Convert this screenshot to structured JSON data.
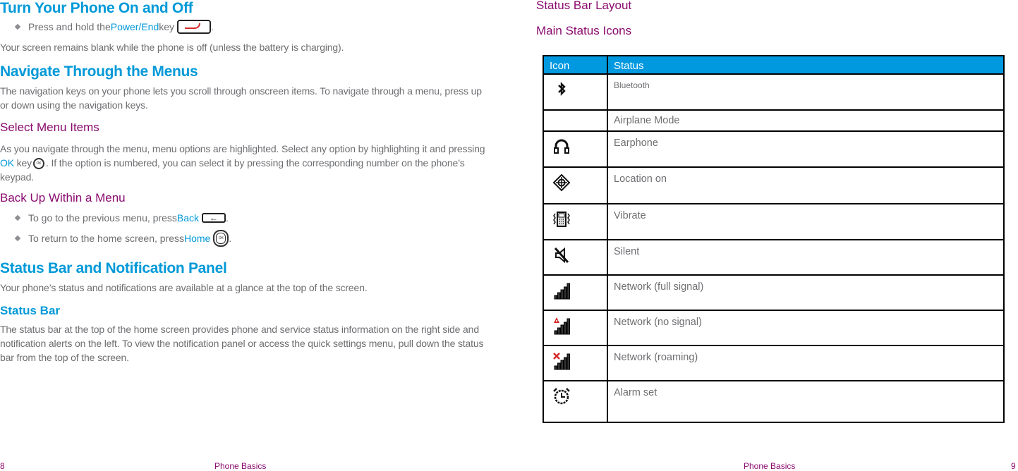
{
  "left_page": {
    "section1": {
      "title": "Turn Your Phone On and Off",
      "bullet": {
        "prefix": "Press and hold the ",
        "keyword": "Power/End",
        "suffix": " key",
        "icon": "power-end-key-icon",
        "end": "."
      },
      "paragraph": "Your screen remains blank while the phone is off (unless the battery is charging)."
    },
    "section2": {
      "title": "Navigate Through the Menus",
      "paragraph": "The navigation keys on your phone lets you scroll through onscreen items. To navigate through a menu, press up or down using the navigation keys."
    },
    "select_menu": {
      "title": "Select Menu Items",
      "text_before": "As you navigate through the menu, menu options are highlighted. Select any option by highlighting it and pressing ",
      "keyword": "OK",
      "text_key": " key",
      "icon_label": "OK",
      "text_after": ". If the option is numbered, you can select it by pressing the corresponding number on the phone’s keypad."
    },
    "back_up": {
      "title": "Back Up Within a Menu",
      "bullets": [
        {
          "prefix": "To go to the previous menu, press ",
          "keyword": "Back",
          "icon": "back-key-icon",
          "end": "."
        },
        {
          "prefix": "To return to the home screen, press ",
          "keyword": "Home",
          "icon": "home-key-icon",
          "icon_label": "OK",
          "end": "."
        }
      ]
    },
    "section3": {
      "title": "Status Bar and Notification Panel",
      "paragraph": "Your phone’s status and notifications are available at a glance at the top of the screen."
    },
    "status_bar": {
      "title": "Status Bar",
      "paragraph": "The status bar at the top of the home screen provides phone and service status information on the right side and notification alerts on the left. To view the notification panel or access the quick settings menu, pull down the status bar from the top of the screen."
    },
    "footer": {
      "page_number": "8",
      "section": "Phone Basics"
    }
  },
  "right_page": {
    "heading1": "Status Bar Layout",
    "heading2": "Main Status Icons",
    "table": {
      "columns": [
        "Icon",
        "Status"
      ],
      "rows": [
        {
          "icon": "bluetooth-icon",
          "status": "Bluetooth"
        },
        {
          "icon": "",
          "status": "Airplane Mode"
        },
        {
          "icon": "earphone-icon",
          "status": "Earphone"
        },
        {
          "icon": "location-icon",
          "status": "Location on"
        },
        {
          "icon": "vibrate-icon",
          "status": "Vibrate"
        },
        {
          "icon": "silent-icon",
          "status": "Silent"
        },
        {
          "icon": "signal-full-icon",
          "status": "Network (full signal)"
        },
        {
          "icon": "signal-none-icon",
          "status": "Network (no signal)"
        },
        {
          "icon": "signal-roaming-icon",
          "status": "Network (roaming)"
        },
        {
          "icon": "alarm-icon",
          "status": "Alarm set"
        }
      ]
    },
    "footer": {
      "section": "Phone Basics",
      "page_number": "9"
    }
  },
  "colors": {
    "heading_blue": "#0099d8",
    "subheading_purple": "#8a0a6e",
    "body_gray": "#6d6e71",
    "table_header_bg": "#0099e0",
    "alert_red": "#d52b2b"
  }
}
